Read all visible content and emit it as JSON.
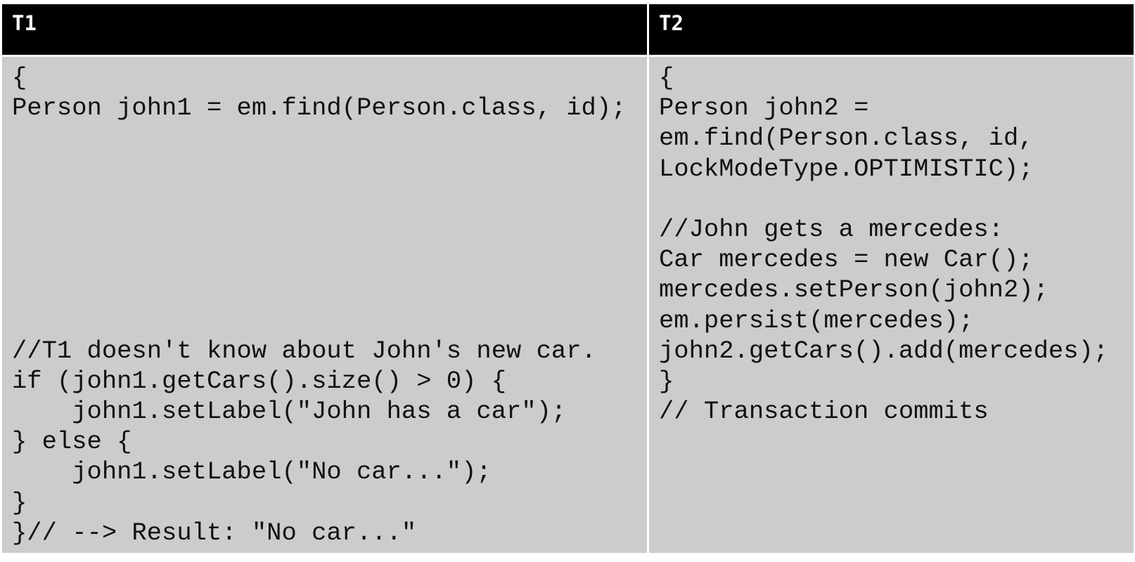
{
  "table": {
    "headers": [
      "T1",
      "T2"
    ],
    "t1_lines": [
      "{",
      "Person john1 = em.find(Person.class, id);",
      "",
      "",
      "",
      "",
      "",
      "",
      "",
      "//T1 doesn't know about John's new car.",
      "if (john1.getCars().size() > 0) {",
      "    john1.setLabel(\"John has a car\");",
      "} else {",
      "    john1.setLabel(\"No car...\");",
      "}",
      "}// --> Result: \"No car...\""
    ],
    "t2_lines": [
      "{",
      "Person john2 =",
      "em.find(Person.class, id,",
      "LockModeType.OPTIMISTIC);",
      "",
      "//John gets a mercedes:",
      "Car mercedes = new Car();",
      "mercedes.setPerson(john2);",
      "em.persist(mercedes);",
      "john2.getCars().add(mercedes);",
      "}",
      "// Transaction commits"
    ]
  }
}
